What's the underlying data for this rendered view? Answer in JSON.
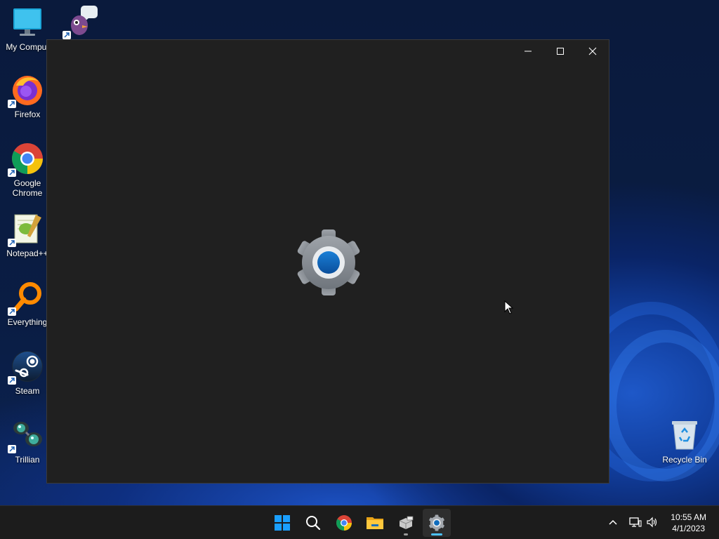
{
  "desktop": {
    "icons": [
      {
        "label": "My Comput",
        "icon": "monitor-icon"
      },
      {
        "label": "",
        "icon": "pidgin-icon"
      },
      {
        "label": "Firefox",
        "icon": "firefox-icon"
      },
      {
        "label": "Google Chrome",
        "icon": "chrome-icon"
      },
      {
        "label": "Notepad++",
        "icon": "notepadpp-icon"
      },
      {
        "label": "Everything",
        "icon": "everything-icon"
      },
      {
        "label": "Steam",
        "icon": "steam-icon"
      },
      {
        "label": "Trillian",
        "icon": "trillian-icon"
      },
      {
        "label": "Recycle Bin",
        "icon": "recycle-bin-icon"
      }
    ]
  },
  "window": {
    "app": "Settings",
    "splash_icon": "settings-gear-icon",
    "controls": [
      "minimize-icon",
      "maximize-icon",
      "close-icon"
    ]
  },
  "taskbar": {
    "buttons": [
      {
        "name": "start",
        "icon": "windows-logo-icon"
      },
      {
        "name": "search",
        "icon": "search-icon"
      },
      {
        "name": "chrome",
        "icon": "chrome-icon"
      },
      {
        "name": "file-explorer",
        "icon": "folder-icon"
      },
      {
        "name": "app",
        "icon": "app-box-icon"
      },
      {
        "name": "settings",
        "icon": "settings-gear-icon",
        "active": true
      }
    ],
    "tray": [
      "chevron-up-icon",
      "network-icon",
      "volume-icon"
    ],
    "clock": {
      "time": "10:55 AM",
      "date": "4/1/2023"
    }
  },
  "colors": {
    "accent": "#0f6cbd",
    "window_bg": "#202020",
    "taskbar_bg": "#1c1c1c"
  }
}
